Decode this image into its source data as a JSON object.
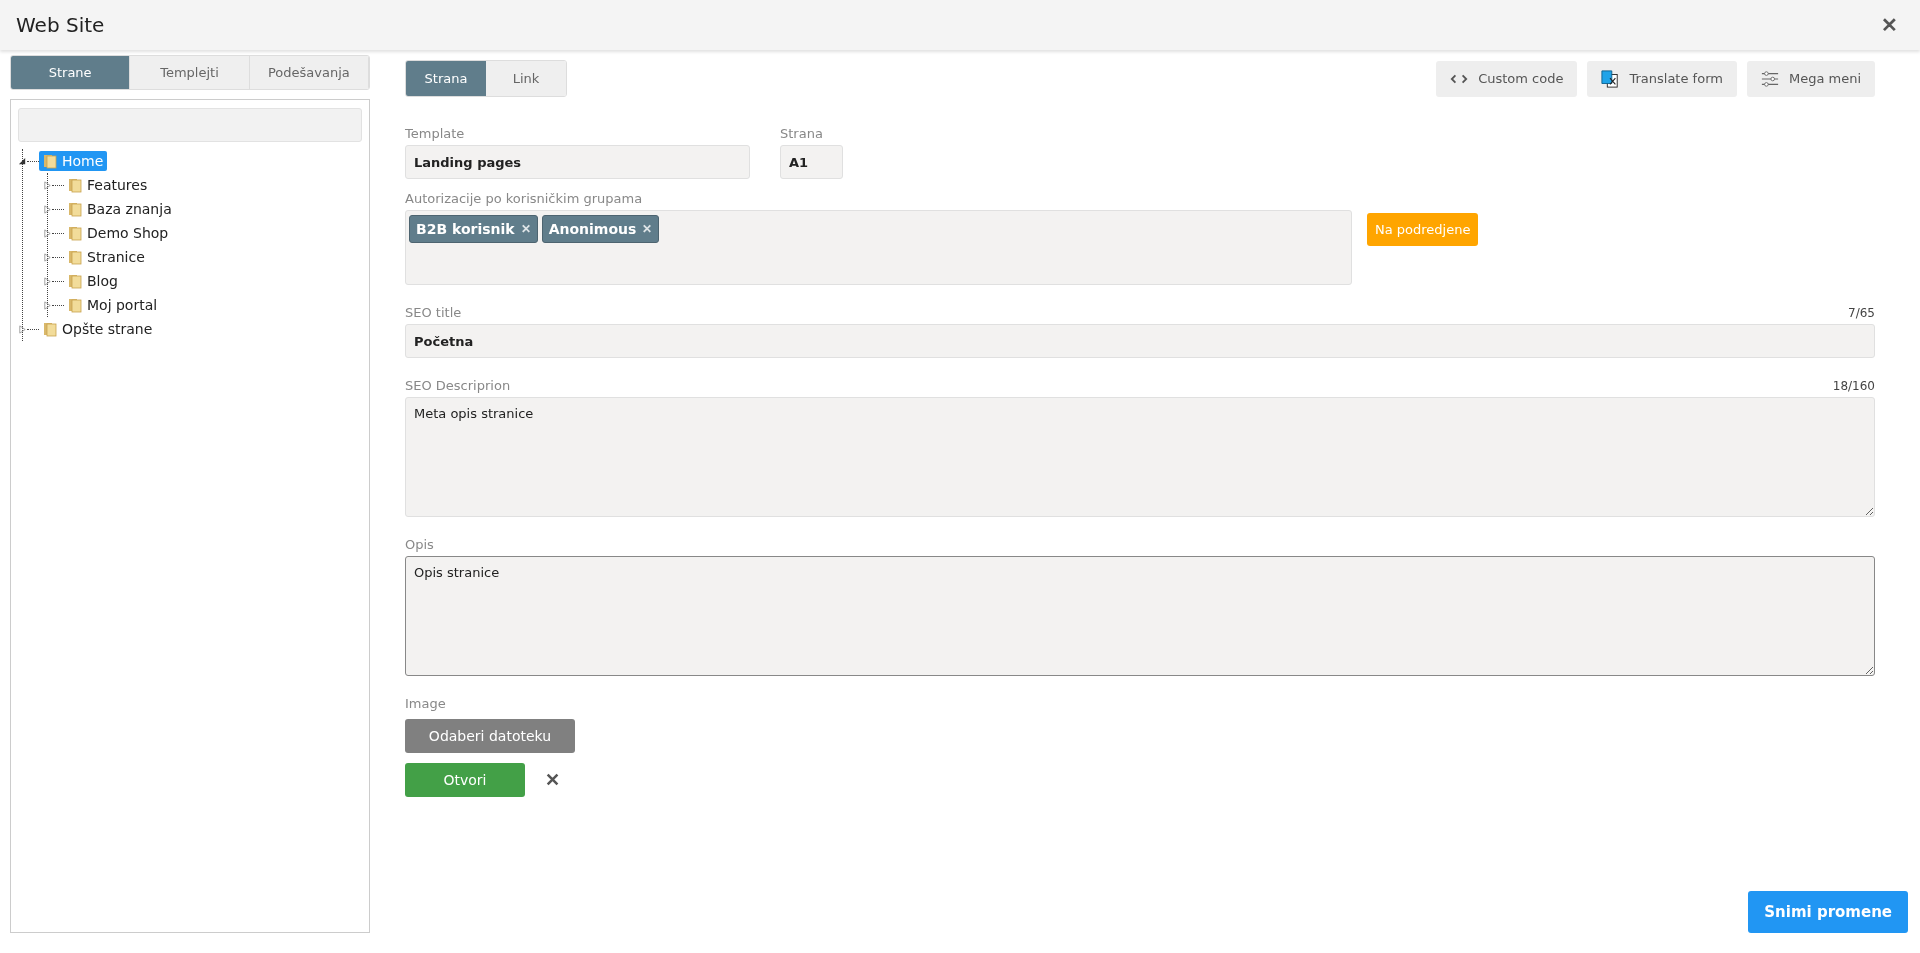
{
  "window": {
    "title": "Web Site",
    "close": "✕"
  },
  "sidebar": {
    "tabs": [
      {
        "label": "Strane",
        "selected": true
      },
      {
        "label": "Templejti",
        "selected": false
      },
      {
        "label": "Podešavanja",
        "selected": false
      }
    ],
    "tree": [
      {
        "label": "Home",
        "selected": true,
        "expanded": true,
        "children": [
          {
            "label": "Features",
            "selected": false,
            "expanded": false
          },
          {
            "label": "Baza znanja",
            "selected": false,
            "expanded": false
          },
          {
            "label": "Demo Shop",
            "selected": false,
            "expanded": false
          },
          {
            "label": "Stranice",
            "selected": false,
            "expanded": false
          },
          {
            "label": "Blog",
            "selected": false,
            "expanded": false
          },
          {
            "label": "Moj portal",
            "selected": false,
            "expanded": false
          }
        ]
      },
      {
        "label": "Opšte strane",
        "selected": false,
        "expanded": false
      }
    ]
  },
  "tabs": [
    {
      "label": "Strana",
      "selected": true
    },
    {
      "label": "Link",
      "selected": false
    }
  ],
  "toolbar": [
    {
      "kind": "code",
      "label": "Custom code"
    },
    {
      "kind": "translate",
      "label": "Translate form"
    },
    {
      "kind": "sliders",
      "label": "Mega meni"
    }
  ],
  "form": {
    "template": {
      "label": "Template",
      "value": "Landing pages"
    },
    "strana": {
      "label": "Strana",
      "value": "A1"
    },
    "authorization": {
      "label": "Autorizacije po korisničkim grupama",
      "tags": [
        {
          "label": "B2B korisnik",
          "remove": "✕"
        },
        {
          "label": "Anonimous",
          "remove": "✕"
        }
      ],
      "button": "Na podredjene"
    },
    "seo_title": {
      "label": "SEO title",
      "counter": "7/65",
      "value": "Početna"
    },
    "seo_description": {
      "label": "SEO Descriprion",
      "counter": "18/160",
      "value": "Meta opis stranice"
    },
    "opis": {
      "label": "Opis",
      "value": "Opis stranice"
    },
    "image": {
      "label": "Image",
      "choose": "Odaberi datoteku",
      "open": "Otvori",
      "remove": "✕"
    }
  },
  "save": "Snimi promene"
}
